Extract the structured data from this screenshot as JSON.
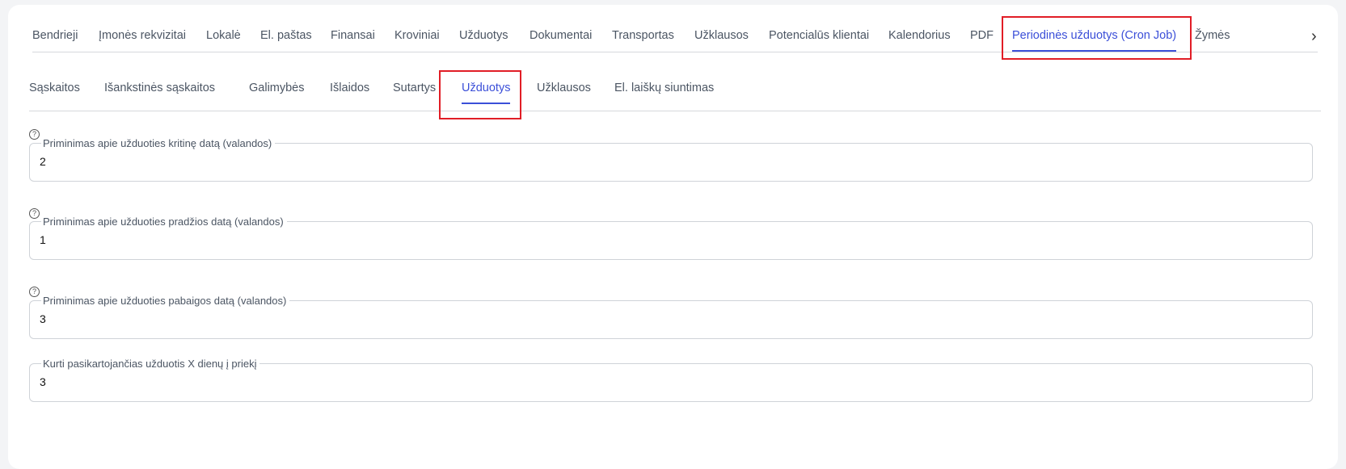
{
  "top_tabs": [
    {
      "label": "Bendrieji"
    },
    {
      "label": "Įmonės rekvizitai"
    },
    {
      "label": "Lokalė"
    },
    {
      "label": "El. paštas"
    },
    {
      "label": "Finansai"
    },
    {
      "label": "Kroviniai"
    },
    {
      "label": "Užduotys"
    },
    {
      "label": "Dokumentai"
    },
    {
      "label": "Transportas"
    },
    {
      "label": "Užklausos"
    },
    {
      "label": "Potencialūs klientai"
    },
    {
      "label": "Kalendorius"
    },
    {
      "label": "PDF"
    },
    {
      "label": "Periodinės užduotys (Cron Job)"
    },
    {
      "label": "Žymės"
    }
  ],
  "active_top_tab": "Periodinės užduotys (Cron Job)",
  "sub_tabs": [
    {
      "label": "Sąskaitos"
    },
    {
      "label": "Išankstinės sąskaitos"
    },
    {
      "label": "Galimybės"
    },
    {
      "label": "Išlaidos"
    },
    {
      "label": "Sutartys"
    },
    {
      "label": "Užduotys"
    },
    {
      "label": "Užklausos"
    },
    {
      "label": "El. laiškų siuntimas"
    }
  ],
  "active_sub_tab": "Užduotys",
  "fields": [
    {
      "label": "Priminimas apie užduoties kritinę datą (valandos)",
      "value": "2",
      "has_help": true
    },
    {
      "label": "Priminimas apie užduoties pradžios datą (valandos)",
      "value": "1",
      "has_help": true
    },
    {
      "label": "Priminimas apie užduoties pabaigos datą (valandos)",
      "value": "3",
      "has_help": true
    },
    {
      "label": "Kurti pasikartojančias užduotis X dienų į priekį",
      "value": "3",
      "has_help": false
    }
  ],
  "icons": {
    "help": "?",
    "scroll_right": "›"
  },
  "colors": {
    "accent": "#3b4fd8",
    "highlight": "#e11d26"
  }
}
